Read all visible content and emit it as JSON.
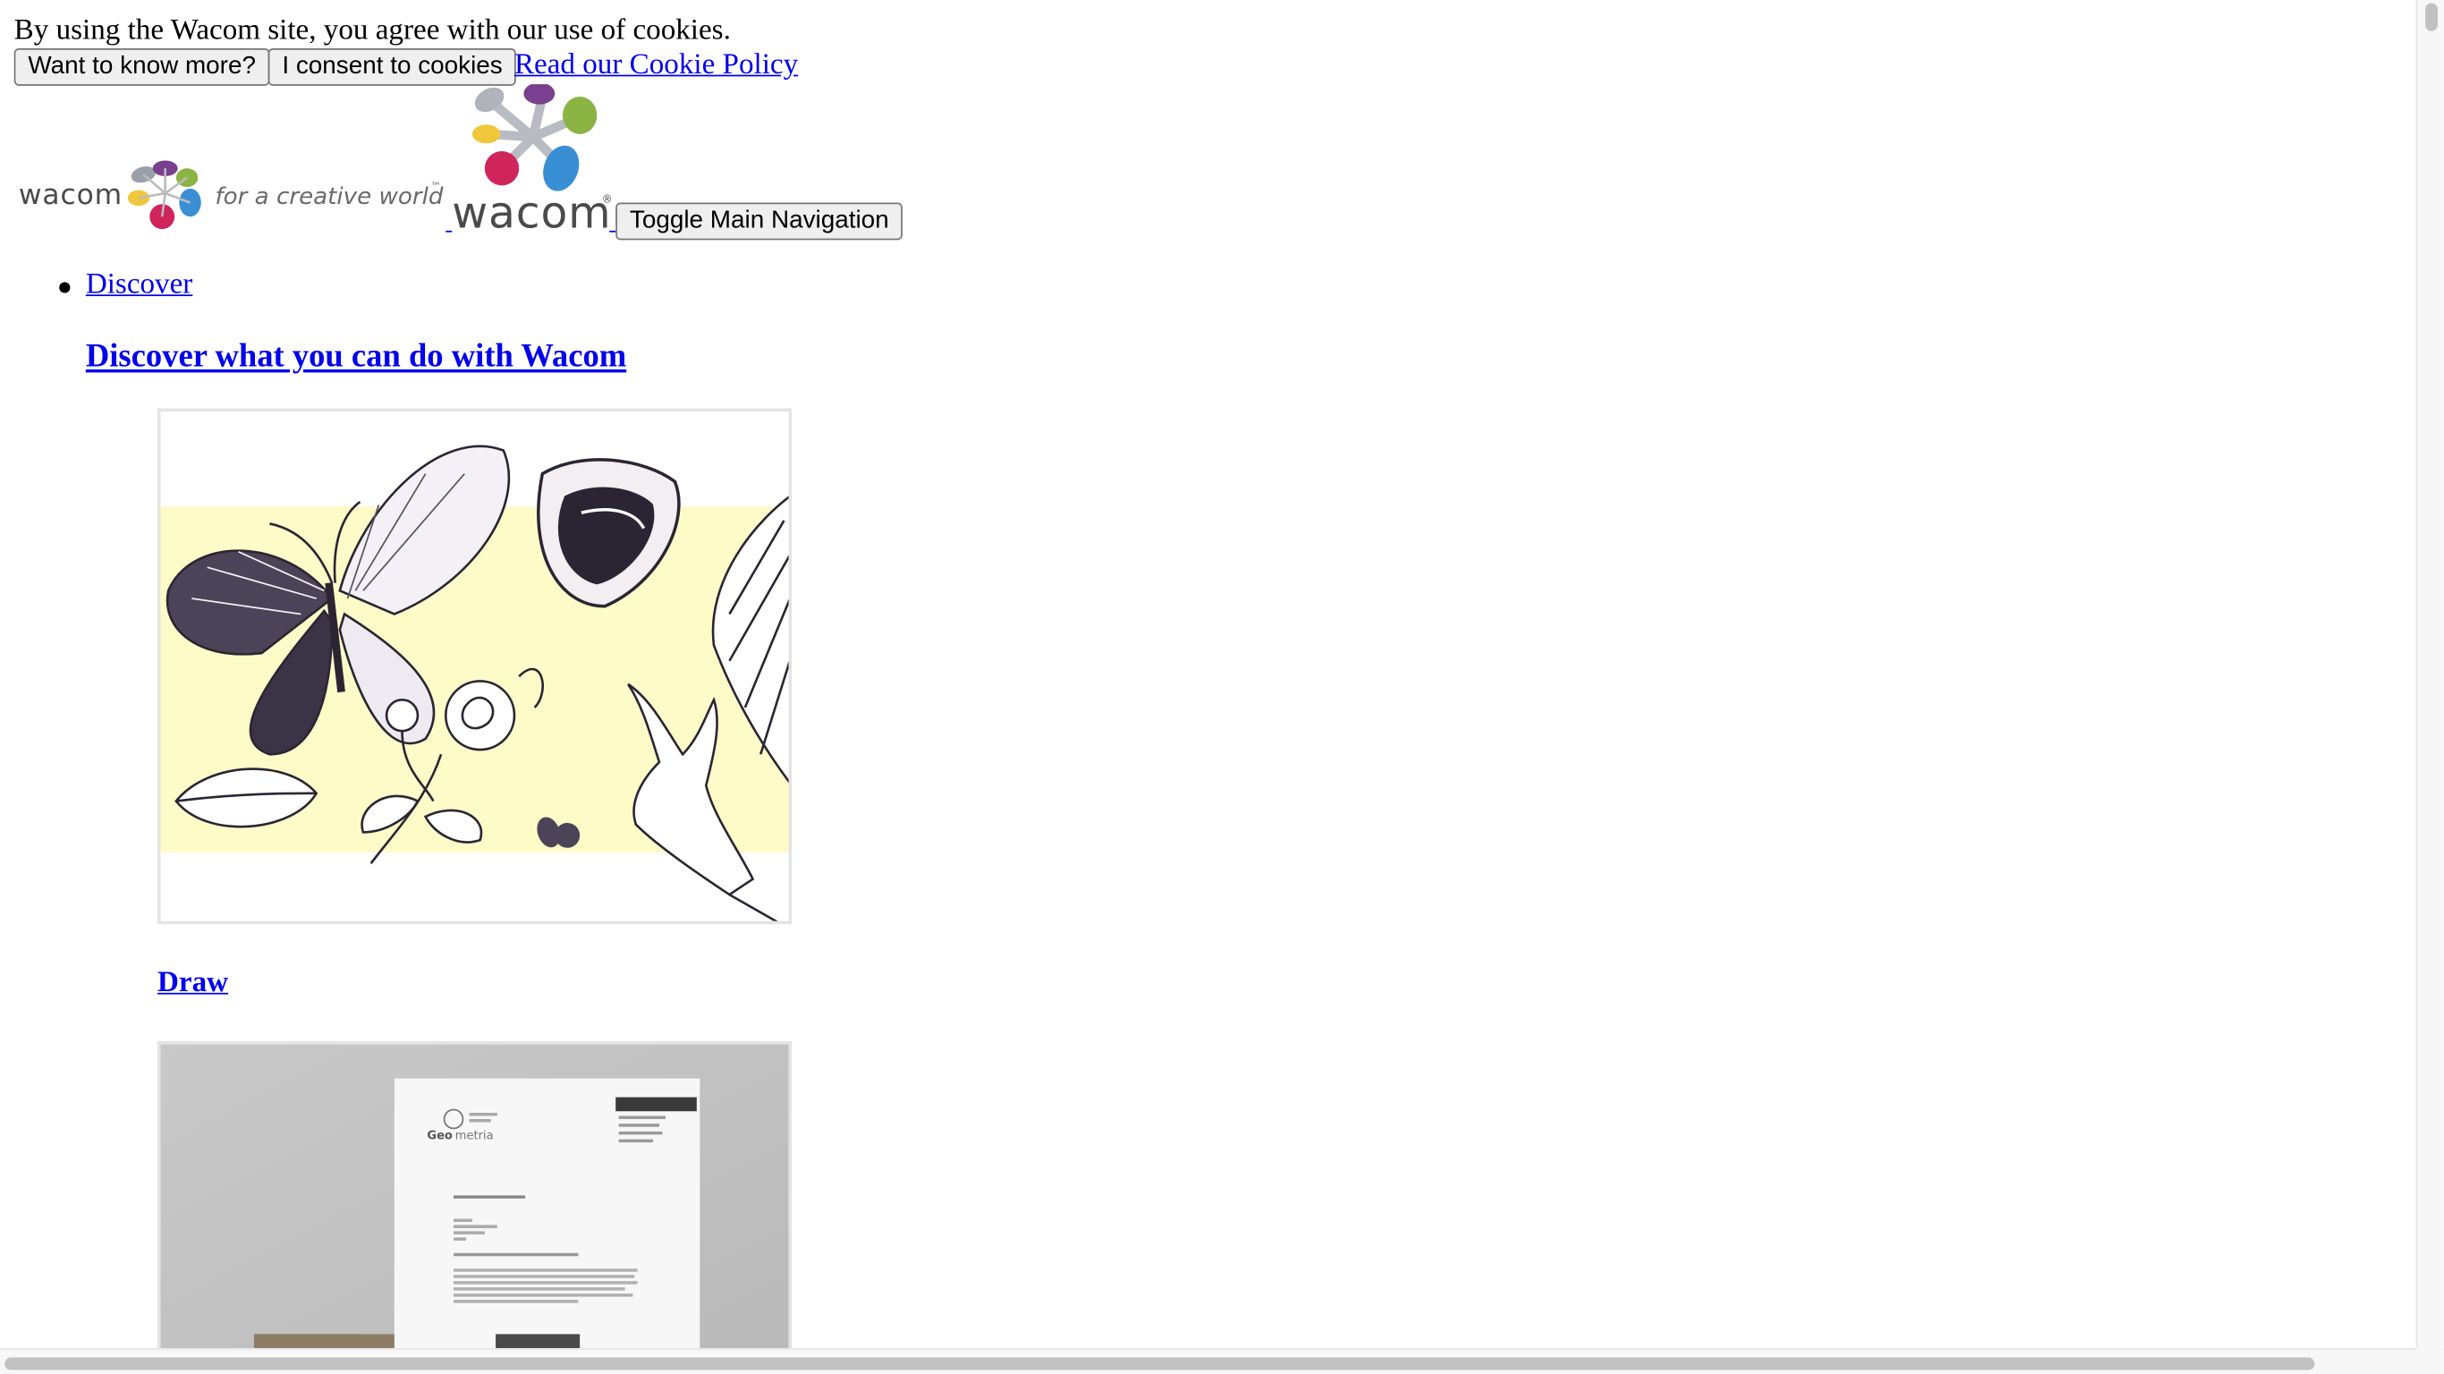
{
  "cookie_banner": {
    "message": "By using the Wacom site, you agree with our use of cookies.",
    "know_more_label": "Want to know more?",
    "consent_label": "I consent to cookies",
    "policy_link": "Read our Cookie Policy"
  },
  "header": {
    "tagline_logo_icon": "wacom-for-a-creative-world-logo",
    "brand_logo_icon": "wacom-logo",
    "toggle_nav_label": "Toggle Main Navigation"
  },
  "nav": {
    "items": [
      {
        "label": "Discover",
        "heading": "Discover what you can do with Wacom",
        "cards": [
          {
            "title": "Draw",
            "image_icon": "sketch-illustration-butterfly"
          },
          {
            "title": "",
            "image_icon": "letterhead-mockup-geometria"
          }
        ]
      }
    ]
  },
  "colors": {
    "link": "#0000ee",
    "wacom_purple": "#7b3f8f",
    "wacom_magenta": "#d0245c",
    "wacom_blue": "#3a8fd4",
    "wacom_green": "#8cb444",
    "wacom_yellow": "#f0c63a",
    "sketch_highlight": "#fdfcc8"
  }
}
